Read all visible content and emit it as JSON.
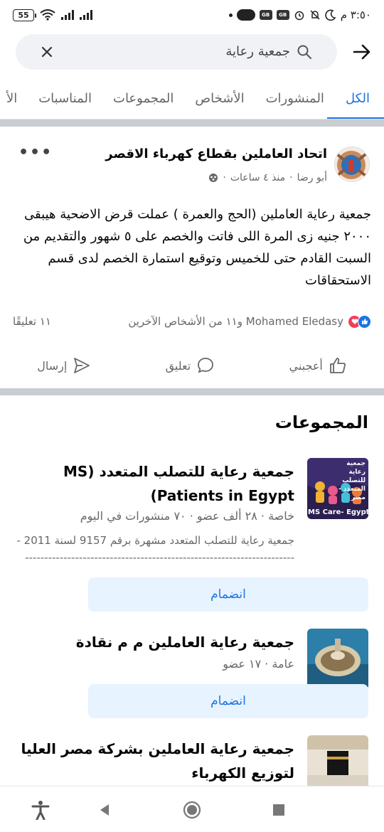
{
  "status_bar": {
    "battery": "55",
    "time": "٣:٥٠ م"
  },
  "search": {
    "query": "جمعية رعاية"
  },
  "tabs": [
    {
      "label": "الكل",
      "active": true
    },
    {
      "label": "المنشورات"
    },
    {
      "label": "الأشخاص"
    },
    {
      "label": "المجموعات"
    },
    {
      "label": "المناسبات"
    },
    {
      "label": "الأ"
    }
  ],
  "post": {
    "title": "اتحاد العاملين بقطاع كهرباء الاقصر",
    "author": "أبو رضا",
    "time": "منذ ٤ ساعات",
    "body": "جمعية رعاية العاملين (الحج والعمرة ) عملت قرض الاضحية هيبقى ٢٠٠٠ جنيه زى المرة اللى فاتت والخصم على ٥ شهور والتقديم من السبت القادم حتى للخميس وتوقيع استمارة الخصم لدى قسم الاستحقاقات",
    "reactions_text": "Mohamed Eledasy و١١ من الأشخاص الآخرين",
    "comments_count": "١١ تعليقًا",
    "actions": {
      "like": "أعجبني",
      "comment": "تعليق",
      "send": "إرسال"
    }
  },
  "groups_heading": "المجموعات",
  "groups": [
    {
      "name": "جمعية رعاية للتصلب المتعدد (MS Patients in Egypt)",
      "meta": "خاصة · ٢٨ ألف عضو · ٧٠ منشورات في اليوم",
      "description": "جمعية رعاية للتصلب المتعدد مشهرة برقم 9157 لسنة 2011 -----------------------------------------------------------------------",
      "thumb_label": "MS Care- Egypt",
      "thumb_title": "جمعية رعاية للتصلب المتعدد - مصر",
      "join": "انضمام"
    },
    {
      "name": "جمعية رعاية العاملين م م نقادة",
      "meta": "عامة · ١٧ عضو",
      "join": "انضمام"
    },
    {
      "name": "جمعية رعاية العاملين بشركة مصر العليا لتوزيع الكهرباء"
    }
  ],
  "colors": {
    "accent": "#1b74e4",
    "join_bg": "#e7f3ff",
    "secondary_text": "#65676b"
  }
}
